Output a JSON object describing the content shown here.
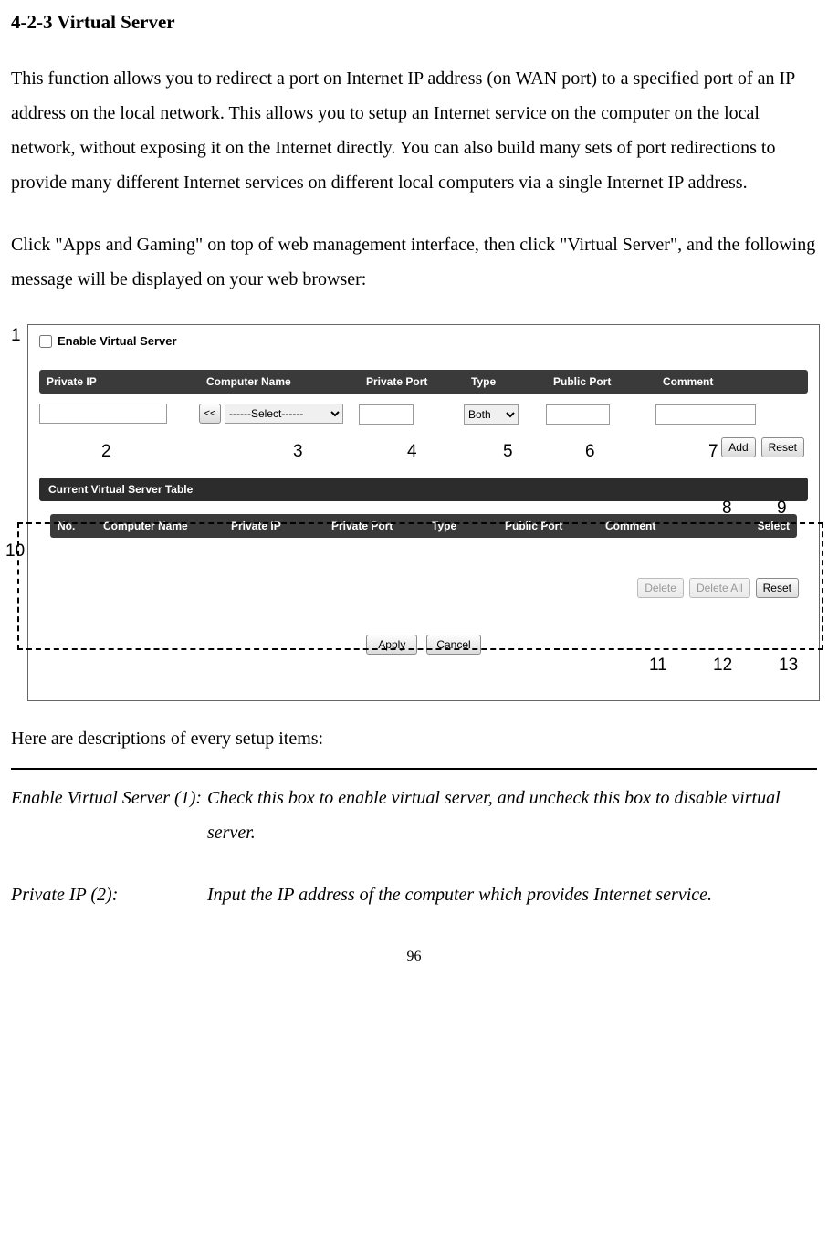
{
  "section_title": "4-2-3 Virtual Server",
  "para1": "This function allows you to redirect a port on Internet IP address (on WAN port) to a specified port of an IP address on the local network. This allows you to setup an Internet service on the computer on the local network, without exposing it on the Internet directly. You can also build many sets of port redirections to provide many different Internet services on different local computers via a single Internet IP address.",
  "para2": "Click \"Apps and Gaming\" on top of web management interface, then click \"Virtual Server\", and the following message will be displayed on your web browser:",
  "ui": {
    "enable_label": "Enable Virtual Server",
    "headers": {
      "private_ip": "Private IP",
      "computer_name": "Computer Name",
      "private_port": "Private Port",
      "type": "Type",
      "public_port": "Public Port",
      "comment": "Comment"
    },
    "assign_btn": "<<",
    "select_placeholder": "------Select------",
    "type_value": "Both",
    "add_btn": "Add",
    "reset_btn": "Reset",
    "table_title": "Current Virtual Server Table",
    "table_headers": {
      "no": "No.",
      "computer_name": "Computer Name",
      "private_ip": "Private IP",
      "private_port": "Private Port",
      "type": "Type",
      "public_port": "Public Port",
      "comment": "Comment",
      "select": "Select"
    },
    "delete_btn": "Delete",
    "delete_all_btn": "Delete All",
    "reset2_btn": "Reset",
    "apply_btn": "Apply",
    "cancel_btn": "Cancel"
  },
  "callouts": {
    "n1": "1",
    "n2": "2",
    "n3": "3",
    "n4": "4",
    "n5": "5",
    "n6": "6",
    "n7": "7",
    "n8": "8",
    "n9": "9",
    "n10": "10",
    "n11": "11",
    "n12": "12",
    "n13": "13"
  },
  "desc_intro": "Here are descriptions of every setup items:",
  "desc": {
    "r1_term": "Enable Virtual Server (1):",
    "r1_def": "Check this box to enable virtual server, and uncheck this box to disable virtual server.",
    "r2_term": "Private IP (2):",
    "r2_def": "Input the IP address of the computer which provides Internet service."
  },
  "page_number": "96"
}
